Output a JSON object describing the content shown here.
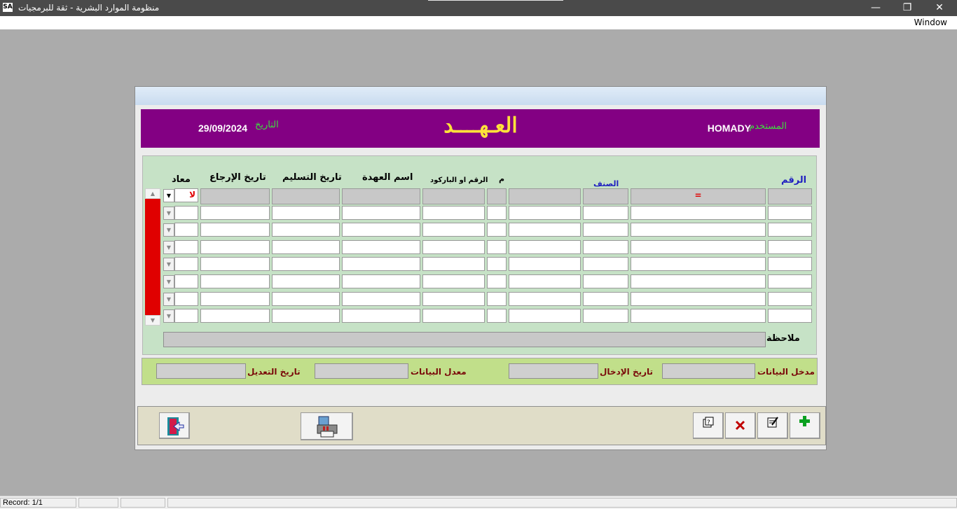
{
  "window": {
    "title": "منظومة الموارد البشرية - ثقة للبرمجيات",
    "app_icon": "app-icon",
    "minimize": "—",
    "restore": "❐",
    "close": "✕"
  },
  "menu": {
    "window": "Window"
  },
  "banner": {
    "user_label": "المستخدم",
    "user_value": "HOMADY",
    "title": "العـهــــد",
    "date_label": "التاريخ",
    "date_value": "29/09/2024"
  },
  "grid": {
    "headers": {
      "number": "الرقم",
      "category": "الصنف",
      "seq": "م",
      "barcode": "الرقم او الباركود",
      "custody_name": "اسم العهدة",
      "delivery_date": "تاريخ التسليم",
      "return_date": "تاريخ الإرجاع",
      "returned": "معاد"
    },
    "first_row": {
      "equals_marker": "=",
      "returned_value": "لا"
    },
    "row_count": 8
  },
  "note": {
    "label": "ملاحظة",
    "value": ""
  },
  "info": {
    "data_entry_label": "مدخل البيانات",
    "entry_date_label": "تاريخ الإدخال",
    "data_modifier_label": "معدل البيانات",
    "modify_date_label": "تاريخ التعديل"
  },
  "toolbar": {
    "add": "add-icon",
    "edit": "edit-icon",
    "delete": "delete-icon",
    "search": "search-icon",
    "print": "print-icon",
    "exit": "exit-icon"
  },
  "status": {
    "record": "Record: 1/1"
  },
  "colors": {
    "banner_bg": "#830083",
    "banner_title": "#ffe23a",
    "banner_label": "#3fdf3f",
    "grid_panel": "#c6e2c6",
    "info_panel": "#c1df8a",
    "scroll_track": "#e00000"
  }
}
